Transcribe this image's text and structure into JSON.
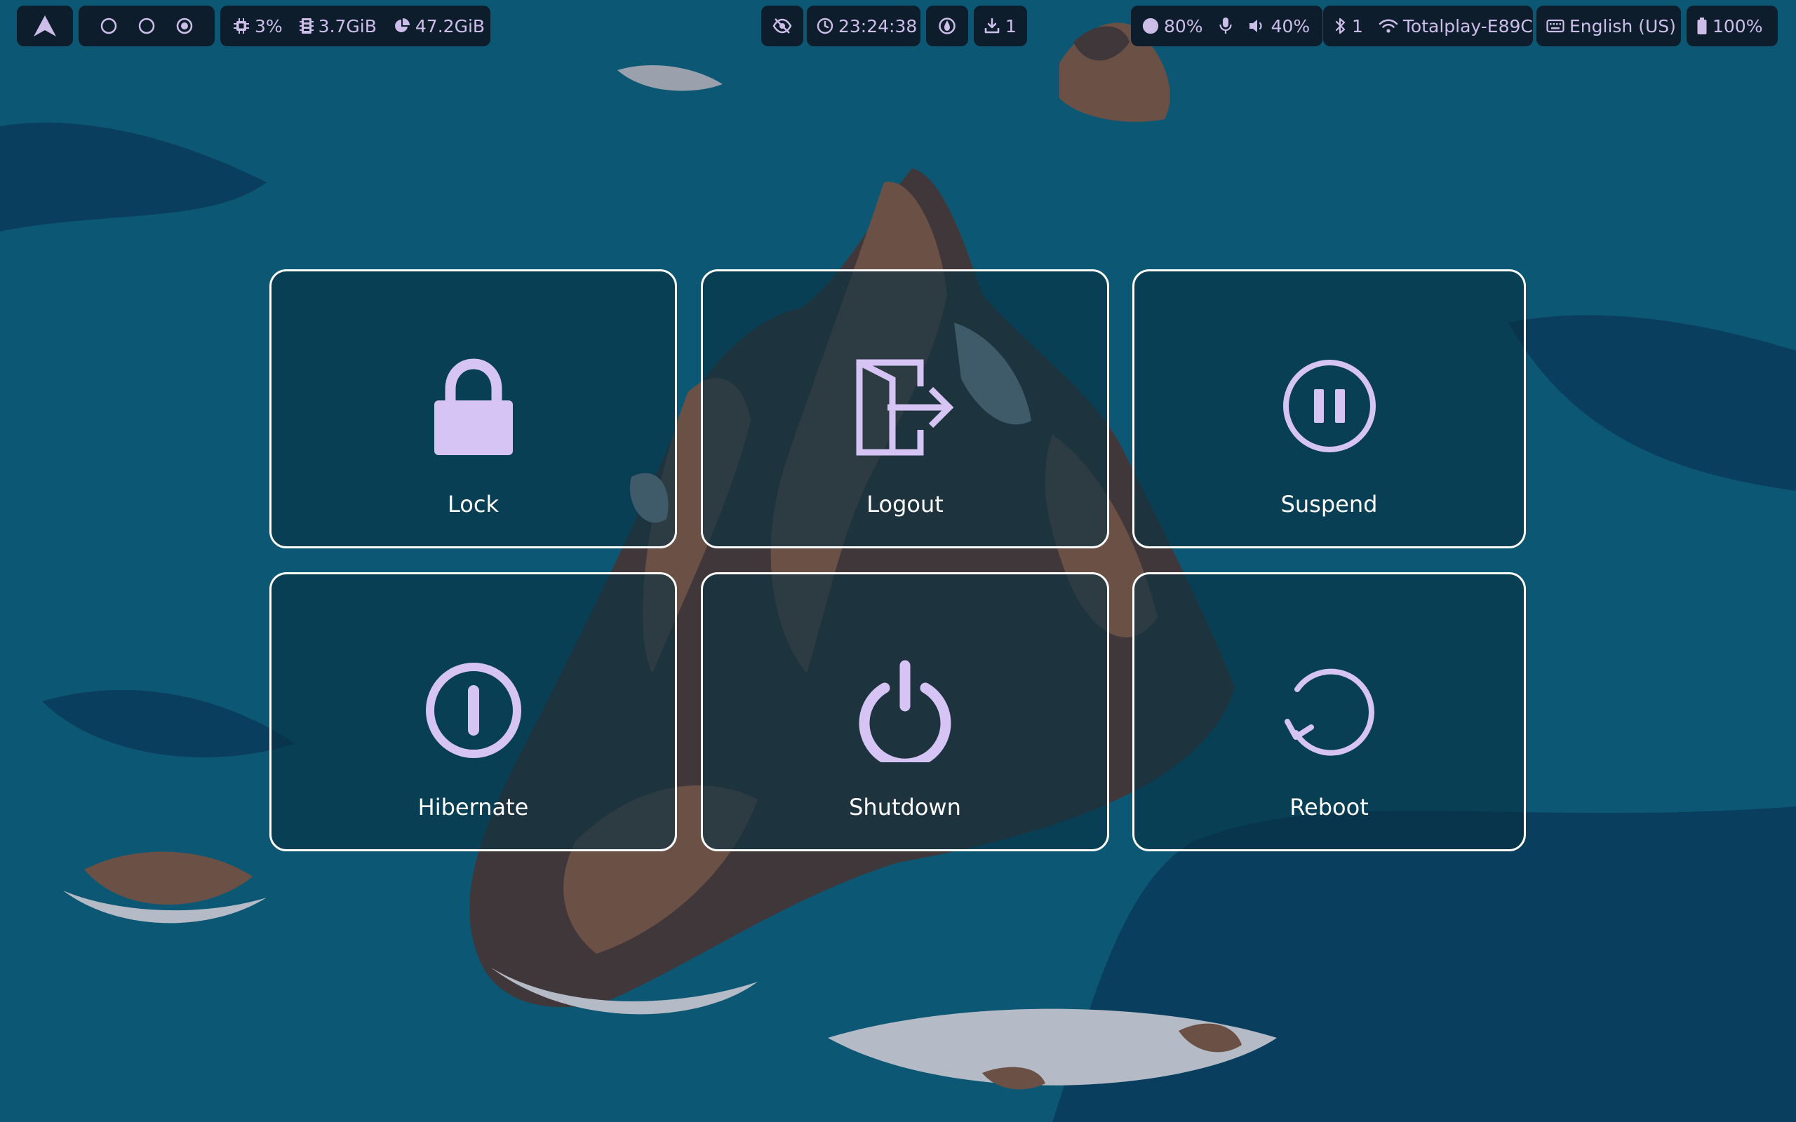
{
  "colors": {
    "accent": "#d6c4f5",
    "bar_background": "#0e1d2b",
    "bar_text": "#cdbde9",
    "tile_border": "#ffffff",
    "sea": "#0c5874"
  },
  "topbar": {
    "launcher": {
      "icon": "arch-logo-icon"
    },
    "workspaces": [
      {
        "icon": "circle-outline-icon",
        "active": false
      },
      {
        "icon": "circle-outline-icon",
        "active": false
      },
      {
        "icon": "circle-dot-icon",
        "active": true
      }
    ],
    "system": {
      "cpu": "3%",
      "memory": "3.7GiB",
      "disk": "47.2GiB"
    },
    "idle_inhibitor": {
      "icon": "eye-off-icon"
    },
    "clock": {
      "time": "23:24:38"
    },
    "gpu": {
      "icon": "gpu-icon"
    },
    "updates": {
      "count": "1"
    },
    "brightness": "80%",
    "microphone": {
      "icon": "microphone-icon"
    },
    "volume": "40%",
    "bluetooth": {
      "devices": "1"
    },
    "network": {
      "ssid": "Totalplay-E89C"
    },
    "keyboard_layout": "English (US)",
    "battery": "100%"
  },
  "power_menu": {
    "lock": {
      "label": "Lock",
      "icon": "lock-icon"
    },
    "logout": {
      "label": "Logout",
      "icon": "logout-icon"
    },
    "suspend": {
      "label": "Suspend",
      "icon": "pause-circle-icon"
    },
    "hibernate": {
      "label": "Hibernate",
      "icon": "hibernate-icon"
    },
    "shutdown": {
      "label": "Shutdown",
      "icon": "power-icon"
    },
    "reboot": {
      "label": "Reboot",
      "icon": "restart-icon"
    }
  }
}
